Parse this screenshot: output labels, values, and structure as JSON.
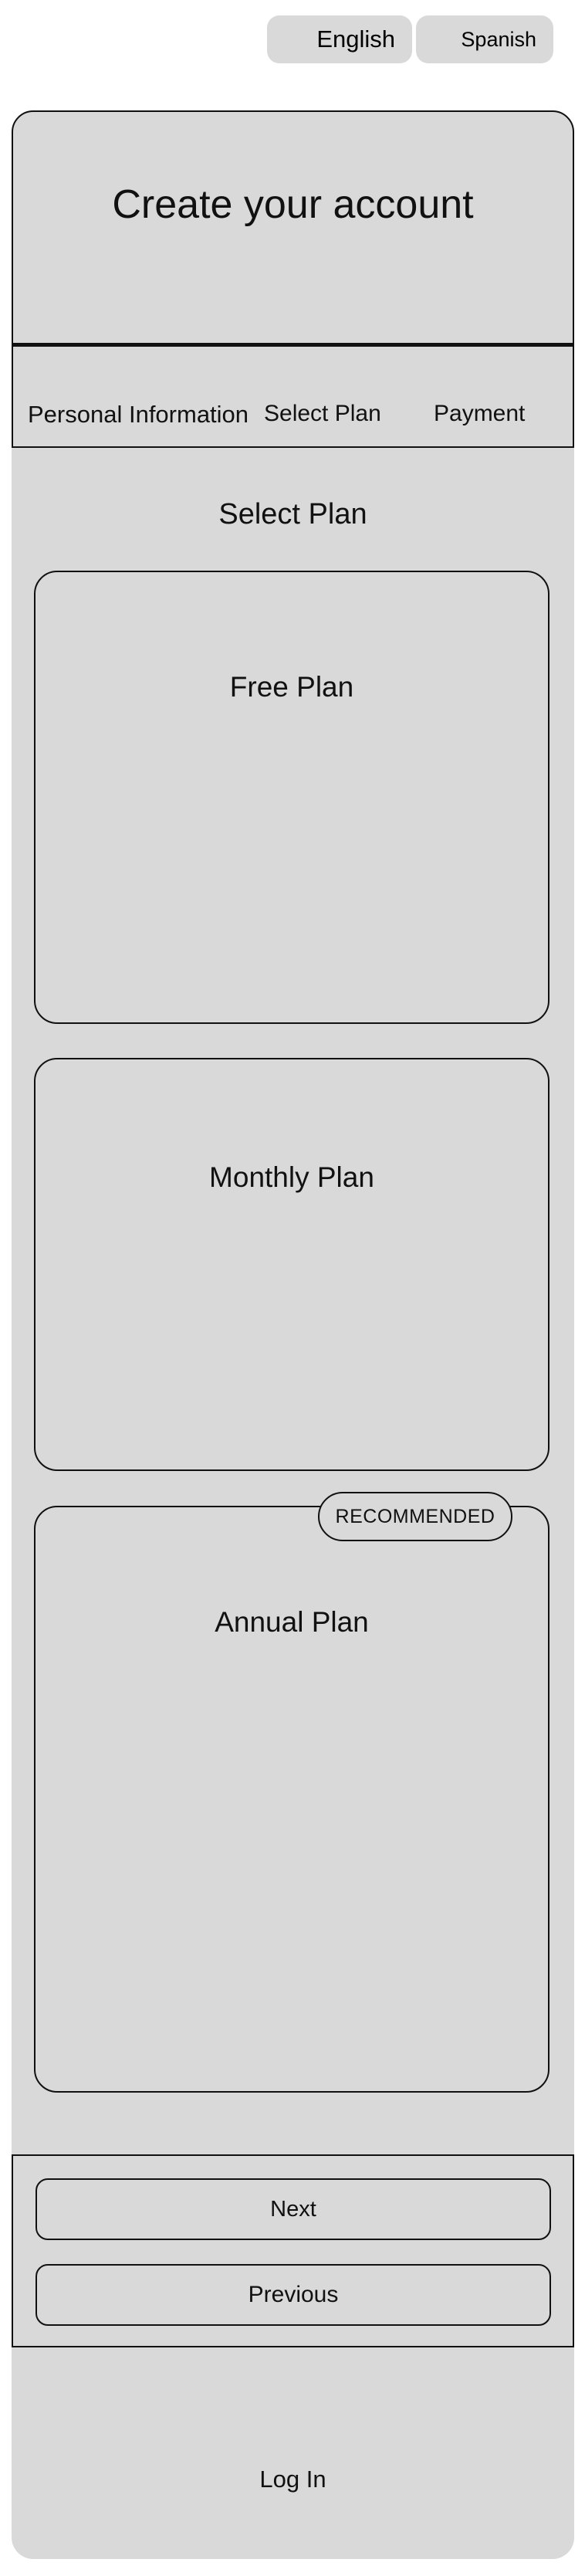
{
  "language": {
    "options": [
      "English",
      "Spanish"
    ]
  },
  "header": {
    "title": "Create your account"
  },
  "steps": {
    "items": [
      "Personal Information",
      "Select Plan",
      "Payment"
    ]
  },
  "main": {
    "section_title": "Select Plan",
    "plans": [
      {
        "name": "Free Plan"
      },
      {
        "name": "Monthly Plan"
      },
      {
        "name": "Annual Plan",
        "badge": "RECOMMENDED"
      }
    ]
  },
  "actions": {
    "next_label": "Next",
    "previous_label": "Previous"
  },
  "footer": {
    "login_label": "Log In"
  },
  "colors": {
    "panel": "#d9d9d9",
    "border": "#111111",
    "background": "#ffffff"
  }
}
